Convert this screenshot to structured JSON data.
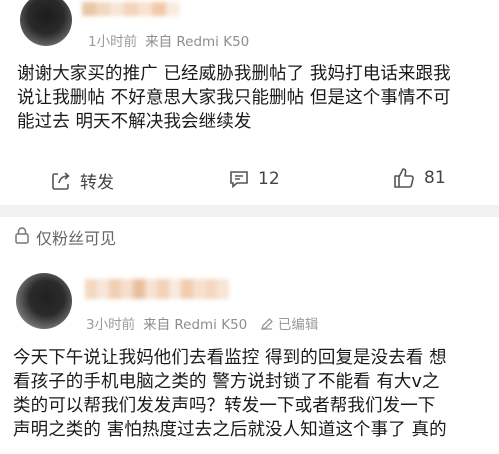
{
  "post1": {
    "time": "1小时前",
    "source": "来自 Redmi K50",
    "text_lines": [
      "谢谢大家买的推广 已经威胁我删帖了 我妈打电话来跟我",
      "说让我删帖 不好意思大家我只能删帖 但是这个事情不可",
      "能过去 明天不解决我会继续发"
    ],
    "actions": {
      "repost_label": "转发",
      "comment_count": "12",
      "like_count": "81"
    }
  },
  "visibility_label": "仅粉丝可见",
  "post2": {
    "time": "3小时前",
    "source": "来自 Redmi K50",
    "edited": "已编辑",
    "text_lines": [
      "今天下午说让我妈他们去看监控 得到的回复是没去看 想",
      "看孩子的手机电脑之类的 警方说封锁了不能看 有大v之",
      "类的可以帮我们发发声吗？转发一下或者帮我们发一下",
      "声明之类的 害怕热度过去之后就没人知道这个事了 真的"
    ]
  },
  "colors": {
    "text": "#1a1a1a",
    "meta": "#9a9a9a",
    "divider": "#f2f2f2"
  },
  "icons": [
    "repost-icon",
    "comment-icon",
    "like-icon",
    "lock-icon",
    "edit-icon"
  ]
}
